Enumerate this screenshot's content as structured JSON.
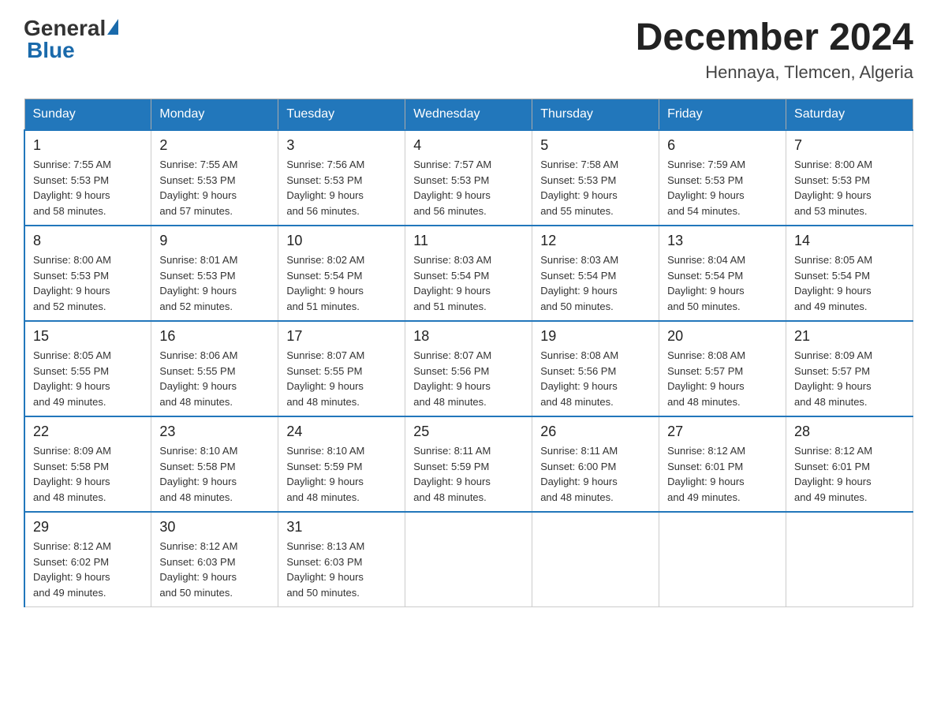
{
  "header": {
    "logo": {
      "general": "General",
      "blue": "Blue"
    },
    "title": "December 2024",
    "location": "Hennaya, Tlemcen, Algeria"
  },
  "calendar": {
    "days_of_week": [
      "Sunday",
      "Monday",
      "Tuesday",
      "Wednesday",
      "Thursday",
      "Friday",
      "Saturday"
    ],
    "weeks": [
      [
        {
          "day": "1",
          "sunrise": "7:55 AM",
          "sunset": "5:53 PM",
          "daylight": "9 hours and 58 minutes."
        },
        {
          "day": "2",
          "sunrise": "7:55 AM",
          "sunset": "5:53 PM",
          "daylight": "9 hours and 57 minutes."
        },
        {
          "day": "3",
          "sunrise": "7:56 AM",
          "sunset": "5:53 PM",
          "daylight": "9 hours and 56 minutes."
        },
        {
          "day": "4",
          "sunrise": "7:57 AM",
          "sunset": "5:53 PM",
          "daylight": "9 hours and 56 minutes."
        },
        {
          "day": "5",
          "sunrise": "7:58 AM",
          "sunset": "5:53 PM",
          "daylight": "9 hours and 55 minutes."
        },
        {
          "day": "6",
          "sunrise": "7:59 AM",
          "sunset": "5:53 PM",
          "daylight": "9 hours and 54 minutes."
        },
        {
          "day": "7",
          "sunrise": "8:00 AM",
          "sunset": "5:53 PM",
          "daylight": "9 hours and 53 minutes."
        }
      ],
      [
        {
          "day": "8",
          "sunrise": "8:00 AM",
          "sunset": "5:53 PM",
          "daylight": "9 hours and 52 minutes."
        },
        {
          "day": "9",
          "sunrise": "8:01 AM",
          "sunset": "5:53 PM",
          "daylight": "9 hours and 52 minutes."
        },
        {
          "day": "10",
          "sunrise": "8:02 AM",
          "sunset": "5:54 PM",
          "daylight": "9 hours and 51 minutes."
        },
        {
          "day": "11",
          "sunrise": "8:03 AM",
          "sunset": "5:54 PM",
          "daylight": "9 hours and 51 minutes."
        },
        {
          "day": "12",
          "sunrise": "8:03 AM",
          "sunset": "5:54 PM",
          "daylight": "9 hours and 50 minutes."
        },
        {
          "day": "13",
          "sunrise": "8:04 AM",
          "sunset": "5:54 PM",
          "daylight": "9 hours and 50 minutes."
        },
        {
          "day": "14",
          "sunrise": "8:05 AM",
          "sunset": "5:54 PM",
          "daylight": "9 hours and 49 minutes."
        }
      ],
      [
        {
          "day": "15",
          "sunrise": "8:05 AM",
          "sunset": "5:55 PM",
          "daylight": "9 hours and 49 minutes."
        },
        {
          "day": "16",
          "sunrise": "8:06 AM",
          "sunset": "5:55 PM",
          "daylight": "9 hours and 48 minutes."
        },
        {
          "day": "17",
          "sunrise": "8:07 AM",
          "sunset": "5:55 PM",
          "daylight": "9 hours and 48 minutes."
        },
        {
          "day": "18",
          "sunrise": "8:07 AM",
          "sunset": "5:56 PM",
          "daylight": "9 hours and 48 minutes."
        },
        {
          "day": "19",
          "sunrise": "8:08 AM",
          "sunset": "5:56 PM",
          "daylight": "9 hours and 48 minutes."
        },
        {
          "day": "20",
          "sunrise": "8:08 AM",
          "sunset": "5:57 PM",
          "daylight": "9 hours and 48 minutes."
        },
        {
          "day": "21",
          "sunrise": "8:09 AM",
          "sunset": "5:57 PM",
          "daylight": "9 hours and 48 minutes."
        }
      ],
      [
        {
          "day": "22",
          "sunrise": "8:09 AM",
          "sunset": "5:58 PM",
          "daylight": "9 hours and 48 minutes."
        },
        {
          "day": "23",
          "sunrise": "8:10 AM",
          "sunset": "5:58 PM",
          "daylight": "9 hours and 48 minutes."
        },
        {
          "day": "24",
          "sunrise": "8:10 AM",
          "sunset": "5:59 PM",
          "daylight": "9 hours and 48 minutes."
        },
        {
          "day": "25",
          "sunrise": "8:11 AM",
          "sunset": "5:59 PM",
          "daylight": "9 hours and 48 minutes."
        },
        {
          "day": "26",
          "sunrise": "8:11 AM",
          "sunset": "6:00 PM",
          "daylight": "9 hours and 48 minutes."
        },
        {
          "day": "27",
          "sunrise": "8:12 AM",
          "sunset": "6:01 PM",
          "daylight": "9 hours and 49 minutes."
        },
        {
          "day": "28",
          "sunrise": "8:12 AM",
          "sunset": "6:01 PM",
          "daylight": "9 hours and 49 minutes."
        }
      ],
      [
        {
          "day": "29",
          "sunrise": "8:12 AM",
          "sunset": "6:02 PM",
          "daylight": "9 hours and 49 minutes."
        },
        {
          "day": "30",
          "sunrise": "8:12 AM",
          "sunset": "6:03 PM",
          "daylight": "9 hours and 50 minutes."
        },
        {
          "day": "31",
          "sunrise": "8:13 AM",
          "sunset": "6:03 PM",
          "daylight": "9 hours and 50 minutes."
        },
        null,
        null,
        null,
        null
      ]
    ]
  }
}
